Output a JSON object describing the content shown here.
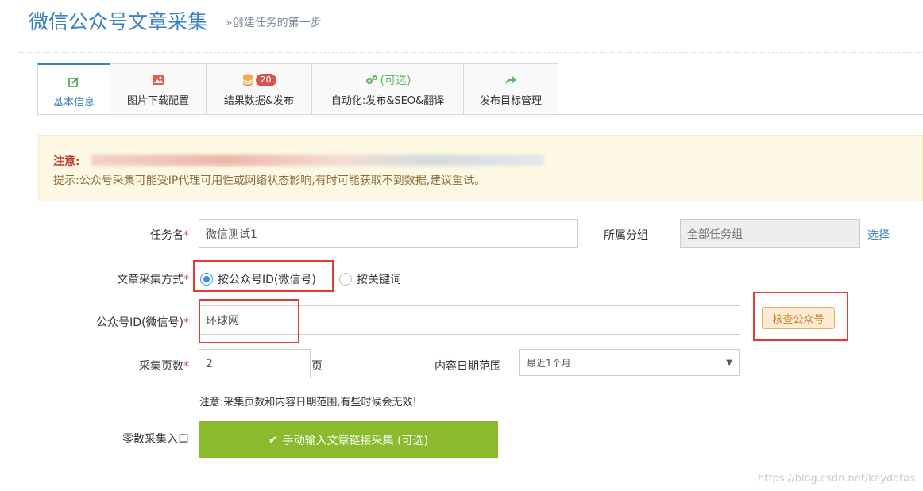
{
  "header": {
    "title": "微信公众号文章采集",
    "subtitle": "»创建任务的第一步"
  },
  "tabs": [
    {
      "label": "基本信息",
      "icon": "edit-icon",
      "active": true
    },
    {
      "label": "图片下载配置",
      "icon": "image-icon",
      "active": false
    },
    {
      "label": "结果数据&发布",
      "icon": "database-icon",
      "badge": "20",
      "active": false
    },
    {
      "label": "自动化:发布&SEO&翻译",
      "icon": "gears-icon",
      "extra": "(可选)",
      "active": false
    },
    {
      "label": "发布目标管理",
      "icon": "share-icon",
      "active": false
    }
  ],
  "notice": {
    "title": "注意:",
    "tip": "提示:公众号采集可能受IP代理可用性或网络状态影响,有时可能获取不到数据,建议重试。"
  },
  "form": {
    "task_name": {
      "label": "任务名",
      "required_mark": "*",
      "value": "微信测试1"
    },
    "group": {
      "label": "所属分组",
      "value": "全部任务组",
      "link": "选择"
    },
    "method": {
      "label": "文章采集方式",
      "required_mark": "*",
      "options": [
        {
          "label": "按公众号ID(微信号)",
          "checked": true
        },
        {
          "label": "按关键词",
          "checked": false
        }
      ]
    },
    "account_id": {
      "label": "公众号ID(微信号)",
      "required_mark": "*",
      "value": "环球网",
      "check_button": "核查公众号"
    },
    "pages": {
      "label": "采集页数",
      "required_mark": "*",
      "value": "2",
      "unit": "页"
    },
    "date_range": {
      "label": "内容日期范围",
      "selected": "最近1个月"
    },
    "note": "注意:采集页数和内容日期范围,有些时候会无效!",
    "manual": {
      "label": "零散采集入口",
      "button": "手动输入文章链接采集 (可选)"
    }
  },
  "watermark": "https://blog.csdn.net/keydatas",
  "colors": {
    "accent": "#3a7fc1",
    "required": "#d9534f",
    "notice_bg": "#fcf8e3",
    "green_button": "#8bba2e",
    "highlight_box": "#e53935"
  }
}
